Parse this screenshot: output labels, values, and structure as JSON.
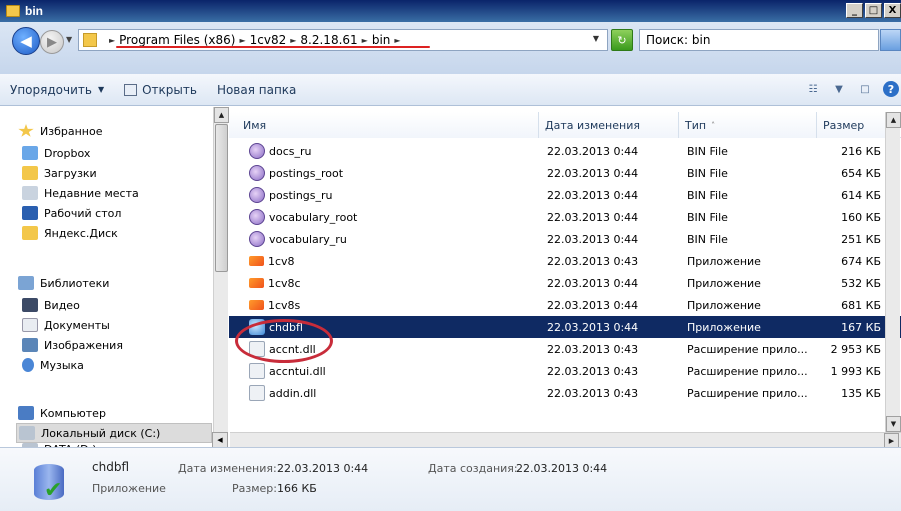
{
  "window": {
    "title": "bin",
    "buttons": [
      "_",
      "□",
      "X"
    ]
  },
  "address": {
    "crumbs": [
      "Program Files (x86)",
      "1cv82",
      "8.2.18.61",
      "bin"
    ],
    "search_placeholder": "Поиск: bin"
  },
  "toolbar": {
    "organize": "Упорядочить",
    "open": "Открыть",
    "new_folder": "Новая папка"
  },
  "nav": {
    "favorites": "Избранное",
    "favorites_items": [
      "Dropbox",
      "Загрузки",
      "Недавние места",
      "Рабочий стол",
      "Яндекс.Диск"
    ],
    "libraries": "Библиотеки",
    "libraries_items": [
      "Видео",
      "Документы",
      "Изображения",
      "Музыка"
    ],
    "computer": "Компьютер",
    "computer_items": [
      "Локальный диск (C:)",
      "DATA (D:)"
    ]
  },
  "columns": {
    "name": "Имя",
    "date": "Дата изменения",
    "type": "Тип",
    "size": "Размер"
  },
  "files": [
    {
      "name": "docs_ru",
      "date": "22.03.2013 0:44",
      "type": "BIN File",
      "size": "216 КБ",
      "icon": "bin"
    },
    {
      "name": "postings_root",
      "date": "22.03.2013 0:44",
      "type": "BIN File",
      "size": "654 КБ",
      "icon": "bin"
    },
    {
      "name": "postings_ru",
      "date": "22.03.2013 0:44",
      "type": "BIN File",
      "size": "614 КБ",
      "icon": "bin"
    },
    {
      "name": "vocabulary_root",
      "date": "22.03.2013 0:44",
      "type": "BIN File",
      "size": "160 КБ",
      "icon": "bin"
    },
    {
      "name": "vocabulary_ru",
      "date": "22.03.2013 0:44",
      "type": "BIN File",
      "size": "251 КБ",
      "icon": "bin"
    },
    {
      "name": "1cv8",
      "date": "22.03.2013 0:43",
      "type": "Приложение",
      "size": "674 КБ",
      "icon": "app"
    },
    {
      "name": "1cv8c",
      "date": "22.03.2013 0:44",
      "type": "Приложение",
      "size": "532 КБ",
      "icon": "app"
    },
    {
      "name": "1cv8s",
      "date": "22.03.2013 0:44",
      "type": "Приложение",
      "size": "681 КБ",
      "icon": "app"
    },
    {
      "name": "chdbfl",
      "date": "22.03.2013 0:44",
      "type": "Приложение",
      "size": "167 КБ",
      "icon": "chd",
      "selected": true
    },
    {
      "name": "accnt.dll",
      "date": "22.03.2013 0:43",
      "type": "Расширение прило...",
      "size": "2 953 КБ",
      "icon": "dll"
    },
    {
      "name": "accntui.dll",
      "date": "22.03.2013 0:43",
      "type": "Расширение прило...",
      "size": "1 993 КБ",
      "icon": "dll"
    },
    {
      "name": "addin.dll",
      "date": "22.03.2013 0:43",
      "type": "Расширение прило...",
      "size": "135 КБ",
      "icon": "dll"
    }
  ],
  "details": {
    "name": "chdbfl",
    "kind": "Приложение",
    "modified_label": "Дата изменения:",
    "modified_value": "22.03.2013 0:44",
    "size_label": "Размер:",
    "size_value": "166 КБ",
    "created_label": "Дата создания:",
    "created_value": "22.03.2013 0:44"
  },
  "colors": {
    "selection": "#0f2a63",
    "annotation": "#c82c3a"
  }
}
